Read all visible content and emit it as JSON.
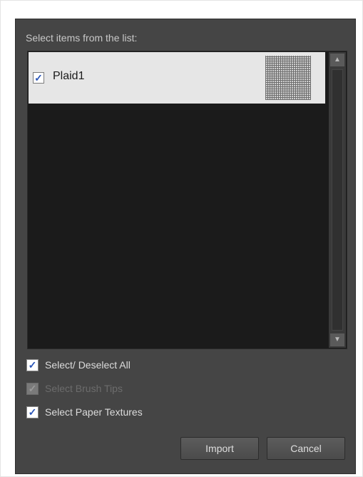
{
  "dialog": {
    "list_label": "Select items from the list:",
    "items": [
      {
        "label": "Plaid1",
        "checked": true,
        "check_glyph": "✓"
      }
    ],
    "scroll_up_glyph": "▲",
    "scroll_down_glyph": "▼"
  },
  "options": [
    {
      "label": "Select/ Deselect All",
      "checked": true,
      "enabled": true,
      "check_glyph": "✓"
    },
    {
      "label": "Select Brush Tips",
      "checked": true,
      "enabled": false,
      "check_glyph": "✓"
    },
    {
      "label": "Select Paper Textures",
      "checked": true,
      "enabled": true,
      "check_glyph": "✓"
    }
  ],
  "buttons": {
    "import_label": "Import",
    "cancel_label": "Cancel"
  },
  "colors": {
    "dialog_bg": "#454545",
    "list_bg": "#1b1b1b",
    "selected_row_bg": "#e6e6e6",
    "check_accent": "#2a55b8"
  }
}
